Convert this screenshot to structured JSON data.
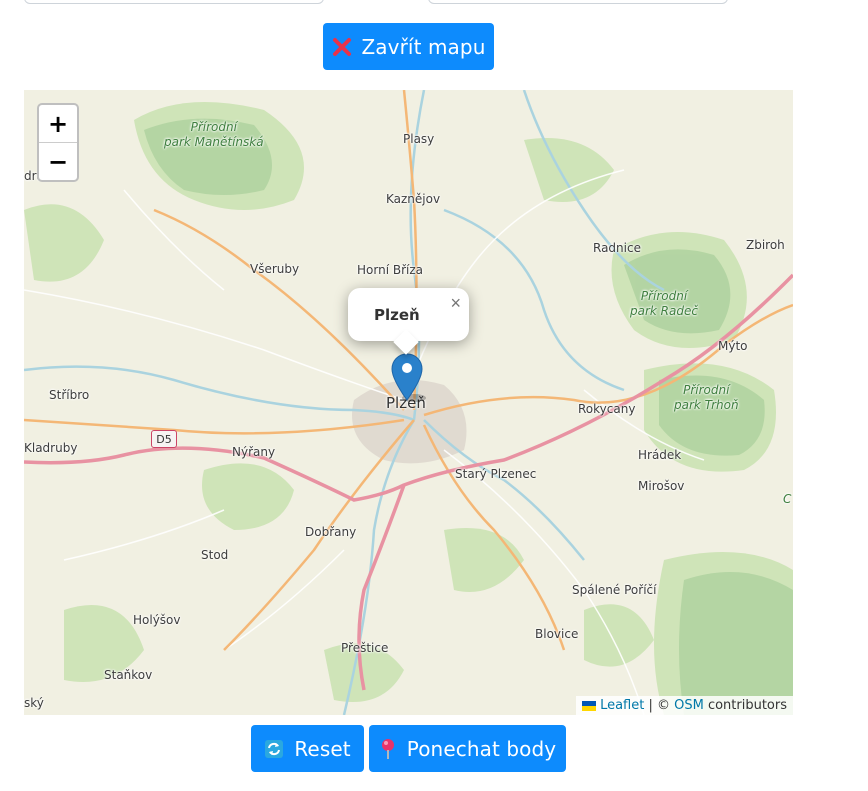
{
  "buttons": {
    "close_map": "Zavřít mapu",
    "reset": "Reset",
    "keep_points": "Ponechat body"
  },
  "map": {
    "zoom_in": "+",
    "zoom_out": "−",
    "popup": {
      "title": "Plzeň",
      "close": "×"
    },
    "attribution": {
      "leaflet": "Leaflet",
      "separator": " | © ",
      "osm": "OSM",
      "contributors": " contributors"
    },
    "road_shield": "D5",
    "places": {
      "plasy": "Plasy",
      "kaznejov": "Kaznějov",
      "radnice": "Radnice",
      "zbiroh": "Zbiroh",
      "vseruby": "Všeruby",
      "horni_briza": "Horní Bříza",
      "myto": "Mýto",
      "stribro": "Stříbro",
      "plzen": "Plzeň",
      "rokycany": "Rokycany",
      "kladruby": "Kladruby",
      "nyrany": "Nýřany",
      "hradek": "Hrádek",
      "stary_plzenec": "Starý Plzenec",
      "mirosov": "Mirošov",
      "dobrany": "Dobřany",
      "stod": "Stod",
      "spalene_porici": "Spálené Poříčí",
      "holysov": "Holýšov",
      "blovice": "Blovice",
      "prestice": "Přeštice",
      "stankov": "Staňkov",
      "zdrazice": "dražice",
      "sky": "ský",
      "c_edge": "C"
    },
    "parks": {
      "manetinska": "Přírodní\npark Manětínská",
      "radec": "Přírodní\npark Radeč",
      "trhon": "Přírodní\npark Trhoň"
    }
  },
  "colors": {
    "button": "#0d8bfd",
    "motorway": "#e892a2",
    "primary_road": "#fcd6a4",
    "forest": "#add19e",
    "water": "#aad3df",
    "marker": "#2a81cb"
  },
  "icons": {
    "close_map": "red-cross-mark-icon",
    "reset": "refresh-arrows-icon",
    "keep_points": "pushpin-icon",
    "marker": "map-marker-icon"
  }
}
